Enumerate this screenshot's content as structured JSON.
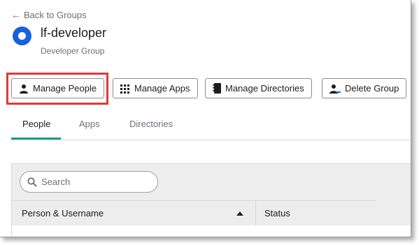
{
  "nav": {
    "back_label": "Back to Groups",
    "back_icon": "arrow-left-icon"
  },
  "group": {
    "name": "lf-developer",
    "description": "Developer Group",
    "logo_color": "#1662dd"
  },
  "actions": [
    {
      "label": "Manage People",
      "icon": "person-icon",
      "highlighted": true
    },
    {
      "label": "Manage Apps",
      "icon": "grid-icon"
    },
    {
      "label": "Manage Directories",
      "icon": "directory-icon"
    },
    {
      "label": "Delete Group",
      "icon": "delete-person-icon"
    }
  ],
  "tabs": [
    {
      "label": "People",
      "active": true
    },
    {
      "label": "Apps",
      "active": false
    },
    {
      "label": "Directories",
      "active": false
    }
  ],
  "search": {
    "placeholder": "Search",
    "icon": "search-icon"
  },
  "table": {
    "columns": [
      {
        "label": "Person & Username",
        "sort": "ascending"
      },
      {
        "label": "Status"
      }
    ]
  },
  "colors": {
    "accent_tab": "#1a9f79",
    "highlight_border": "#e0393a"
  }
}
